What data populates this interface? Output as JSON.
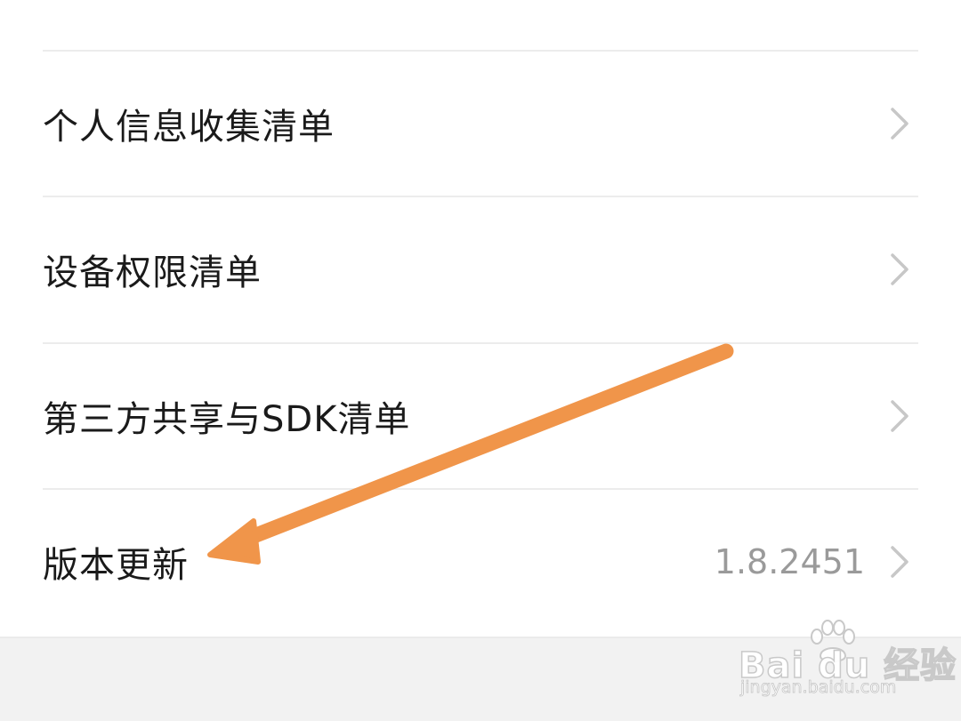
{
  "settings": {
    "items": [
      {
        "label": "个人信息收集清单",
        "value": ""
      },
      {
        "label": "设备权限清单",
        "value": ""
      },
      {
        "label": "第三方共享与SDK清单",
        "value": ""
      },
      {
        "label": "版本更新",
        "value": "1.8.2451"
      }
    ]
  },
  "annotation": {
    "arrow_color": "#f0954a"
  },
  "watermark": {
    "main_text": "Bai du 经验",
    "sub_text": "jingyan.baidu.com"
  },
  "colors": {
    "background": "#ffffff",
    "footer_background": "#f2f2f2",
    "label_text": "#1a1a1a",
    "value_text": "#9a9a9a",
    "chevron": "#c7c7c7",
    "divider": "#ececec"
  }
}
